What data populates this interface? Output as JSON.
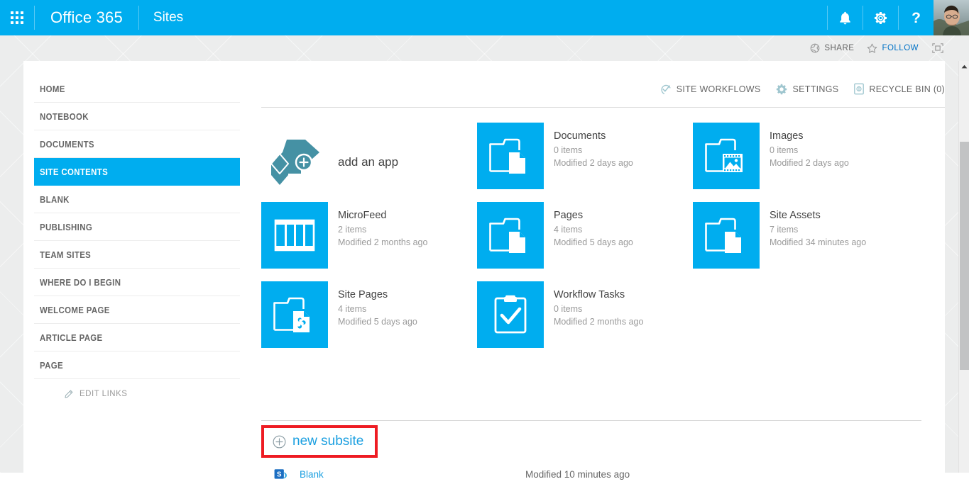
{
  "suite_bar": {
    "waffle_label": "app-launcher",
    "brand": "Office 365",
    "app": "Sites",
    "notifications_icon": "bell-icon",
    "settings_icon": "gear-icon",
    "help_label": "?",
    "avatar_label": "user-avatar"
  },
  "ribbon": {
    "share": "SHARE",
    "follow": "FOLLOW",
    "focus_label": "focus-on-content"
  },
  "quicklaunch": {
    "items": [
      {
        "label": "HOME",
        "selected": false
      },
      {
        "label": "NOTEBOOK",
        "selected": false
      },
      {
        "label": "DOCUMENTS",
        "selected": false
      },
      {
        "label": "SITE CONTENTS",
        "selected": true
      },
      {
        "label": "BLANK",
        "selected": false
      },
      {
        "label": "PUBLISHING",
        "selected": false
      },
      {
        "label": "TEAM SITES",
        "selected": false
      },
      {
        "label": "WHERE DO I BEGIN",
        "selected": false
      },
      {
        "label": "WELCOME PAGE",
        "selected": false
      },
      {
        "label": "ARTICLE PAGE",
        "selected": false
      },
      {
        "label": "PAGE",
        "selected": false
      }
    ],
    "edit_links": "EDIT LINKS"
  },
  "command_bar": {
    "site_workflows": "SITE WORKFLOWS",
    "settings": "SETTINGS",
    "recycle_bin": "RECYCLE BIN (0)"
  },
  "add_app": {
    "label": "add an app"
  },
  "tiles": [
    {
      "title": "Documents",
      "items": "0 items",
      "modified": "Modified 2 days ago",
      "icon": "folder-document-icon"
    },
    {
      "title": "Images",
      "items": "0 items",
      "modified": "Modified 2 days ago",
      "icon": "folder-picture-icon"
    },
    {
      "title": "MicroFeed",
      "items": "2 items",
      "modified": "Modified 2 months ago",
      "icon": "list-columns-icon"
    },
    {
      "title": "Pages",
      "items": "4 items",
      "modified": "Modified 5 days ago",
      "icon": "folder-document-icon"
    },
    {
      "title": "Site Assets",
      "items": "7 items",
      "modified": "Modified 34 minutes ago",
      "icon": "folder-document-icon"
    },
    {
      "title": "Site Pages",
      "items": "4 items",
      "modified": "Modified 5 days ago",
      "icon": "folder-wikipage-icon"
    },
    {
      "title": "Workflow Tasks",
      "items": "0 items",
      "modified": "Modified 2 months ago",
      "icon": "clipboard-check-icon"
    }
  ],
  "subsites": {
    "new_subsite": "new subsite",
    "rows": [
      {
        "name": "Blank",
        "modified": "Modified 10 minutes ago",
        "icon": "sharepoint-icon"
      }
    ]
  },
  "colors": {
    "brand_blue": "#00adef",
    "link_blue": "#1a9fe0",
    "highlight_red": "#ee1c23",
    "addapp_teal": "#4591a4",
    "text_gray": "#666666",
    "muted_gray": "#9a9a9a"
  }
}
